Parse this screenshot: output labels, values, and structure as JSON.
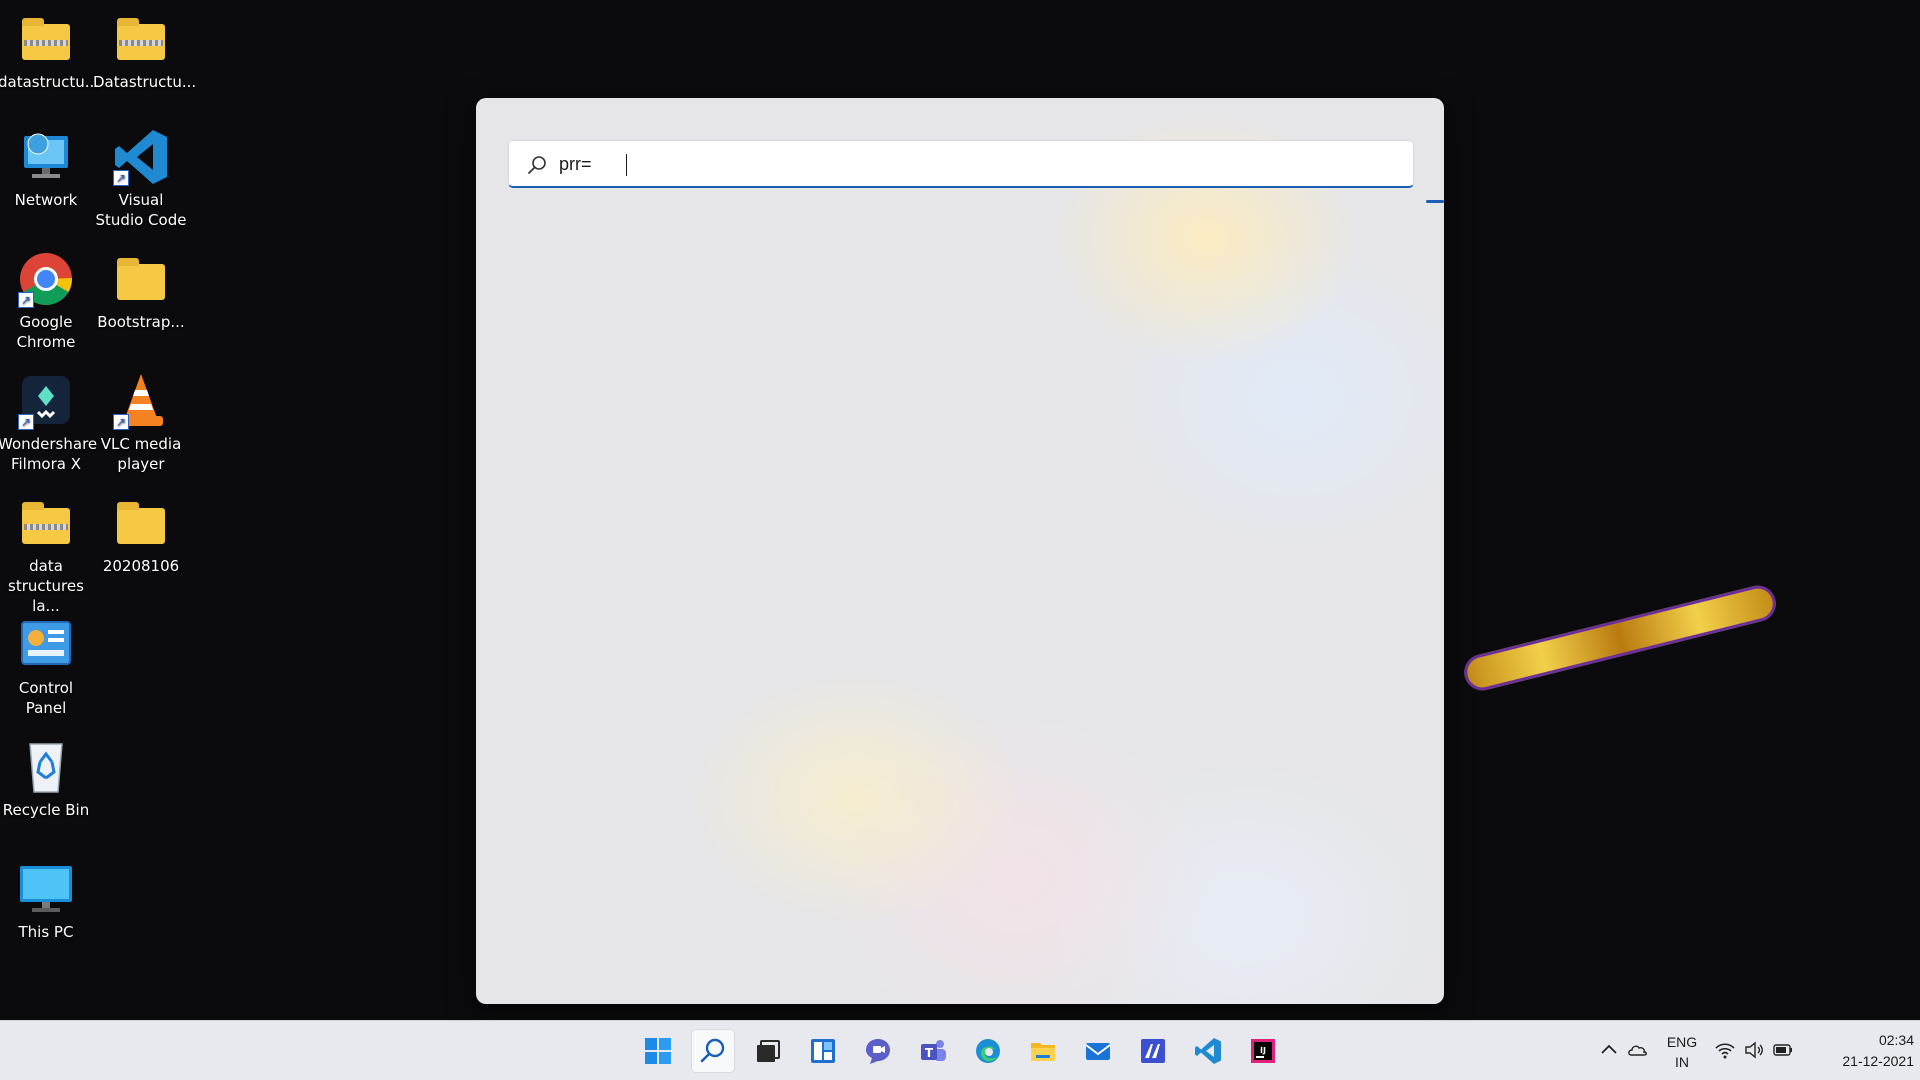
{
  "desktop": {
    "icons": [
      {
        "label": "datastructu...",
        "icon": "zip-folder-icon"
      },
      {
        "label": "Datastructu...",
        "icon": "zip-folder-icon"
      },
      {
        "label": "Network",
        "icon": "network-icon"
      },
      {
        "label": "Visual Studio Code",
        "icon": "vscode-icon"
      },
      {
        "label": "Google Chrome",
        "icon": "chrome-icon"
      },
      {
        "label": "Bootstrap...",
        "icon": "folder-icon"
      },
      {
        "label": "Wondershare Filmora X",
        "icon": "filmora-icon"
      },
      {
        "label": "VLC media player",
        "icon": "vlc-icon"
      },
      {
        "label": "data structures la...",
        "icon": "zip-folder-icon"
      },
      {
        "label": "20208106",
        "icon": "folder-icon"
      },
      {
        "label": "Control Panel",
        "icon": "control-panel-icon"
      },
      {
        "label": "Recycle Bin",
        "icon": "recycle-bin-icon"
      },
      {
        "label": "This PC",
        "icon": "this-pc-icon"
      }
    ]
  },
  "search": {
    "value": "prr=",
    "icon": "search-icon"
  },
  "taskbar": {
    "apps": [
      {
        "name": "start",
        "icon": "windows-start-icon"
      },
      {
        "name": "search",
        "icon": "search-icon",
        "active": true
      },
      {
        "name": "task-view",
        "icon": "task-view-icon"
      },
      {
        "name": "widgets",
        "icon": "widgets-icon"
      },
      {
        "name": "chat",
        "icon": "chat-icon"
      },
      {
        "name": "teams",
        "icon": "teams-icon"
      },
      {
        "name": "edge",
        "icon": "edge-icon"
      },
      {
        "name": "file-explorer",
        "icon": "file-explorer-icon"
      },
      {
        "name": "mail",
        "icon": "mail-icon"
      },
      {
        "name": "app",
        "icon": "app-icon"
      },
      {
        "name": "vscode",
        "icon": "vscode-icon"
      },
      {
        "name": "intellij",
        "icon": "intellij-icon"
      }
    ],
    "tray": {
      "language_top": "ENG",
      "language_bottom": "IN",
      "time": "02:34",
      "date": "21-12-2021"
    }
  },
  "colors": {
    "accent": "#1a5fb4",
    "folder": "#f6c844",
    "taskbar": "#e7e9ee"
  }
}
